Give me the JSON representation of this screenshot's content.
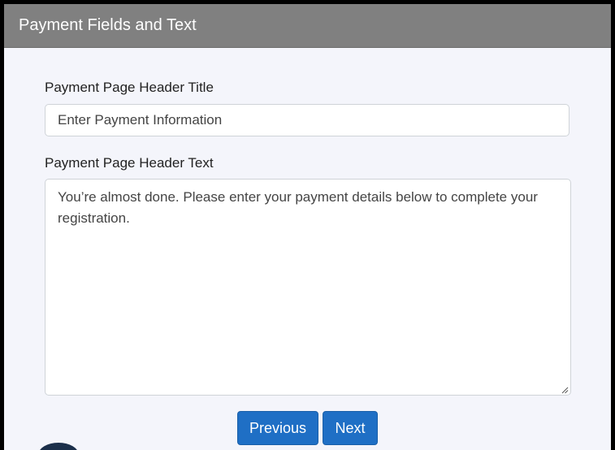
{
  "panel": {
    "title": "Payment Fields and Text",
    "header_color": "#808080"
  },
  "fields": {
    "header_title": {
      "label": "Payment Page Header Title",
      "value": "Enter Payment Information"
    },
    "header_text": {
      "label": "Payment Page Header Text",
      "value": "You’re almost done. Please enter your payment details below to complete your registration."
    }
  },
  "buttons": {
    "previous_label": "Previous",
    "next_label": "Next",
    "color": "#1f6fc5"
  },
  "icons": {
    "resize_grip": "resize-grip-icon",
    "avatar": "avatar"
  }
}
